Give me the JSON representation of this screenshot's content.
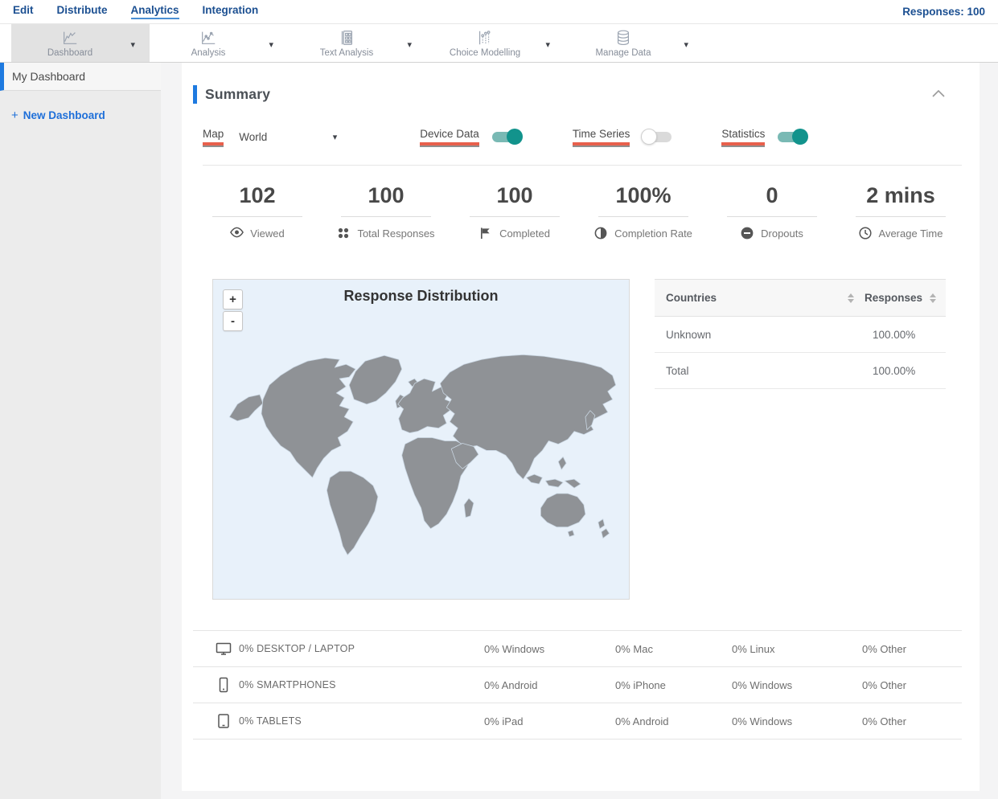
{
  "topnav": {
    "items": [
      {
        "label": "Edit",
        "active": false
      },
      {
        "label": "Distribute",
        "active": false
      },
      {
        "label": "Analytics",
        "active": true
      },
      {
        "label": "Integration",
        "active": false
      }
    ],
    "responses": "Responses: 100"
  },
  "toolbar": {
    "items": [
      {
        "label": "Dashboard",
        "icon": "line-chart-icon",
        "selected": true
      },
      {
        "label": "Analysis",
        "icon": "line-chart-points-icon",
        "selected": false
      },
      {
        "label": "Text Analysis",
        "icon": "document-grid-icon",
        "selected": false
      },
      {
        "label": "Choice Modelling",
        "icon": "scatter-chart-icon",
        "selected": false
      },
      {
        "label": "Manage Data",
        "icon": "database-icon",
        "selected": false
      }
    ],
    "caret": "▾"
  },
  "sidebar": {
    "active_item": "My Dashboard",
    "new_dashboard": {
      "plus": "+",
      "label": "New Dashboard"
    }
  },
  "summary": {
    "title": "Summary",
    "controls": {
      "map_label": "Map",
      "map_value": "World",
      "caret": "▾",
      "toggles": [
        {
          "label": "Device Data",
          "on": true
        },
        {
          "label": "Time Series",
          "on": false
        },
        {
          "label": "Statistics",
          "on": true
        }
      ]
    },
    "stats": [
      {
        "value": "102",
        "label": "Viewed",
        "icon": "eye-icon"
      },
      {
        "value": "100",
        "label": "Total Responses",
        "icon": "dots-grid-icon"
      },
      {
        "value": "100",
        "label": "Completed",
        "icon": "flag-icon"
      },
      {
        "value": "100%",
        "label": "Completion Rate",
        "icon": "half-circle-icon"
      },
      {
        "value": "0",
        "label": "Dropouts",
        "icon": "minus-circle-icon"
      },
      {
        "value": "2 mins",
        "label": "Average Time",
        "icon": "clock-icon"
      }
    ],
    "map": {
      "title": "Response Distribution",
      "zoom_in": "+",
      "zoom_out": "-",
      "land_color": "#8f9296",
      "background": "#e8f1fa"
    },
    "countries_table": {
      "col_countries": "Countries",
      "col_responses": "Responses",
      "rows": [
        {
          "country": "Unknown",
          "responses": "100.00%"
        },
        {
          "country": "Total",
          "responses": "100.00%"
        }
      ]
    },
    "devices": [
      {
        "type": "0% DESKTOP / LAPTOP",
        "icon": "desktop-icon",
        "breakdown": [
          "0% Windows",
          "0% Mac",
          "0% Linux",
          "0% Other"
        ]
      },
      {
        "type": "0% SMARTPHONES",
        "icon": "smartphone-icon",
        "breakdown": [
          "0% Android",
          "0% iPhone",
          "0% Windows",
          "0% Other"
        ]
      },
      {
        "type": "0% TABLETS",
        "icon": "tablet-icon",
        "breakdown": [
          "0% iPad",
          "0% Android",
          "0% Windows",
          "0% Other"
        ]
      }
    ]
  },
  "colors": {
    "nav_blue": "#1b4f91",
    "link_blue": "#1e6fd9",
    "accent_blue": "#1e7ae0",
    "toggle_teal": "#12938c",
    "underline_red": "#e8604c"
  }
}
